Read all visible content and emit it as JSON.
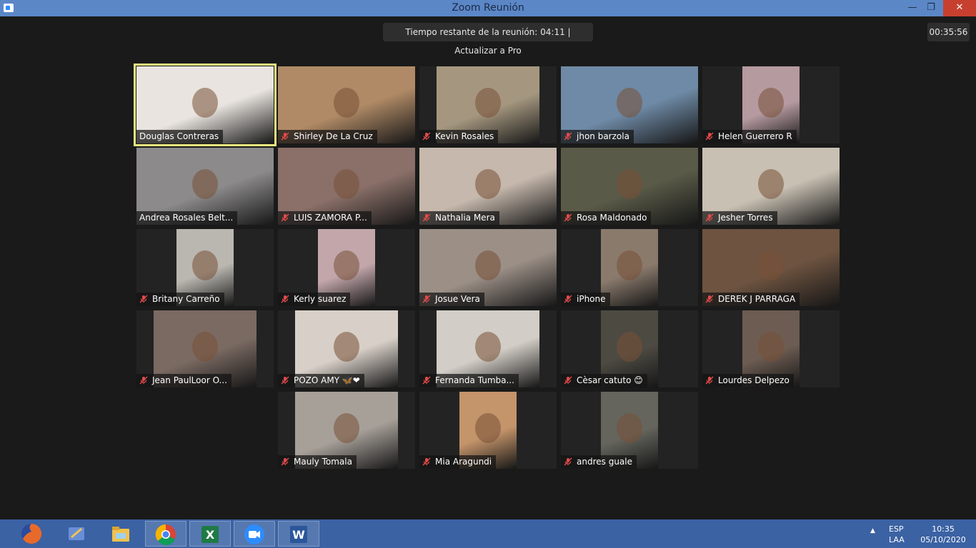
{
  "window": {
    "title": "Zoom Reunión",
    "minimize_glyph": "—",
    "maximize_glyph": "❐",
    "close_glyph": "✕"
  },
  "meeting": {
    "time_banner": "Tiempo restante de la reunión: 04:11 | Actualizar a Pro",
    "elapsed": "00:35:56"
  },
  "participants": [
    {
      "name": "Douglas Contreras",
      "muted": false,
      "active": true,
      "bg": "#e9e4df"
    },
    {
      "name": "Shirley De La Cruz",
      "muted": true,
      "bg": "#b08a66"
    },
    {
      "name": "Kevin Rosales",
      "muted": true,
      "bg": "#a5977f"
    },
    {
      "name": "jhon barzola",
      "muted": true,
      "bg": "#6f8aa6"
    },
    {
      "name": "Helen Guerrero R",
      "muted": true,
      "bg": "#b59aa0"
    },
    {
      "name": "Andrea Rosales Belt...",
      "muted": false,
      "bg": "#8c8a8a"
    },
    {
      "name": "LUIS ZAMORA P...",
      "muted": true,
      "bg": "#8a7068"
    },
    {
      "name": "Nathalia Mera",
      "muted": true,
      "bg": "#c6b8ac"
    },
    {
      "name": "Rosa Maldonado",
      "muted": true,
      "bg": "#5a5a48"
    },
    {
      "name": "Jesher Torres",
      "muted": true,
      "bg": "#c8c0b2"
    },
    {
      "name": "Britany Carreño",
      "muted": true,
      "bg": "#bab7b0"
    },
    {
      "name": "Kerly suarez",
      "muted": true,
      "bg": "#c2a6aa"
    },
    {
      "name": "Josue Vera",
      "muted": true,
      "bg": "#9b8f86"
    },
    {
      "name": "iPhone",
      "muted": true,
      "bg": "#8a7a6c"
    },
    {
      "name": "DEREK J PARRAGA",
      "muted": true,
      "bg": "#6d5340"
    },
    {
      "name": "Jean PaulLoor O...",
      "muted": true,
      "bg": "#7a6a62"
    },
    {
      "name": "POZO AMY 🦋❤",
      "muted": true,
      "bg": "#d8d0c8"
    },
    {
      "name": "Fernanda Tumba...",
      "muted": true,
      "bg": "#d2cdc6"
    },
    {
      "name": "Cèsar catuto 😊",
      "muted": true,
      "bg": "#4d4a42"
    },
    {
      "name": "Lourdes Delpezo",
      "muted": true,
      "bg": "#6c5c52"
    },
    {
      "name": "Mauly Tomala",
      "muted": true,
      "bg": "#a7a099"
    },
    {
      "name": "Mia Aragundi",
      "muted": true,
      "bg": "#c4946a"
    },
    {
      "name": "andres guale",
      "muted": true,
      "bg": "#65655e"
    }
  ],
  "taskbar": {
    "apps": [
      {
        "icon": "firefox-icon",
        "color": "#e86a2a",
        "open": false
      },
      {
        "icon": "paint-icon",
        "color": "#6a8fd8",
        "open": false
      },
      {
        "icon": "file-explorer-icon",
        "color": "#f2c24e",
        "open": false
      },
      {
        "icon": "chrome-icon",
        "color": "#4caf50",
        "open": true
      },
      {
        "icon": "excel-icon",
        "color": "#1f7a45",
        "open": true
      },
      {
        "icon": "zoom-icon",
        "color": "#2d8cff",
        "open": true
      },
      {
        "icon": "word-icon",
        "color": "#2b579a",
        "open": true
      }
    ],
    "tray": {
      "chevron": "▲",
      "lang_top": "ESP",
      "lang_bottom": "LAA",
      "time": "10:35",
      "date": "05/10/2020"
    }
  }
}
